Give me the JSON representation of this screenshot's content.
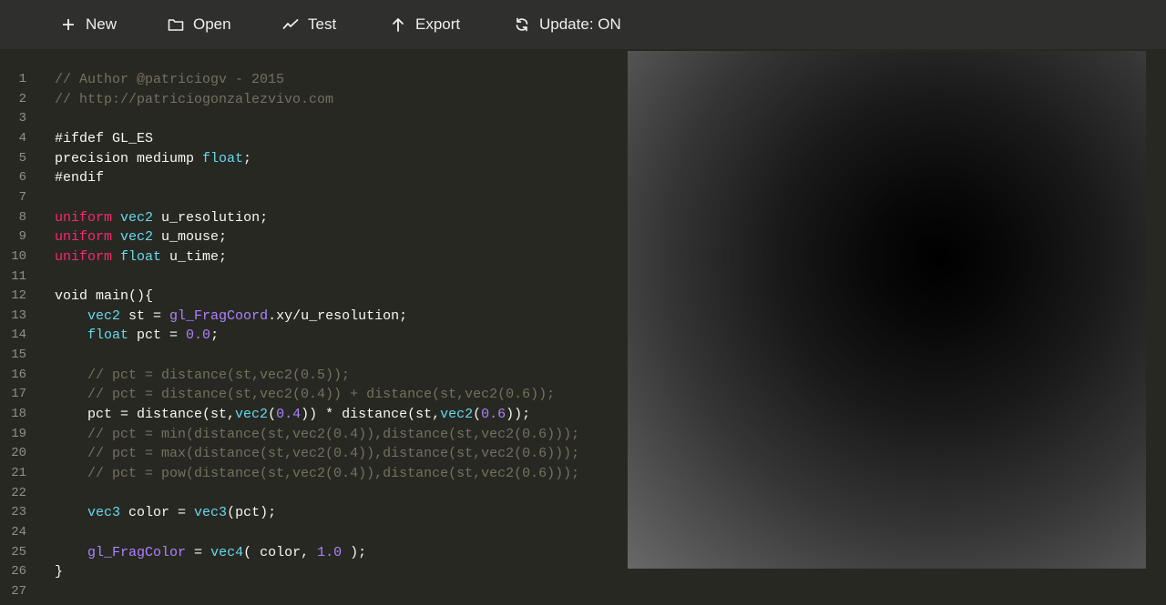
{
  "menu": {
    "items": [
      {
        "label": "New",
        "icon": "plus-icon"
      },
      {
        "label": "Open",
        "icon": "folder-icon"
      },
      {
        "label": "Test",
        "icon": "chart-line-icon"
      },
      {
        "label": "Export",
        "icon": "arrow-up-icon"
      },
      {
        "label": "Update: ON",
        "icon": "refresh-icon"
      }
    ]
  },
  "editor": {
    "line_numbers": [
      "1",
      "2",
      "3",
      "4",
      "5",
      "6",
      "7",
      "8",
      "9",
      "10",
      "11",
      "12",
      "13",
      "14",
      "15",
      "16",
      "17",
      "18",
      "19",
      "20",
      "21",
      "22",
      "23",
      "24",
      "25",
      "26",
      "27"
    ],
    "lines": [
      "// Author @patriciogv - 2015",
      "// http://patriciogonzalezvivo.com",
      "",
      "#ifdef GL_ES",
      "precision mediump float;",
      "#endif",
      "",
      "uniform vec2 u_resolution;",
      "uniform vec2 u_mouse;",
      "uniform float u_time;",
      "",
      "void main(){",
      "    vec2 st = gl_FragCoord.xy/u_resolution;",
      "    float pct = 0.0;",
      "",
      "    // pct = distance(st,vec2(0.5));",
      "    // pct = distance(st,vec2(0.4)) + distance(st,vec2(0.6));",
      "    pct = distance(st,vec2(0.4)) * distance(st,vec2(0.6));",
      "    // pct = min(distance(st,vec2(0.4)),distance(st,vec2(0.6)));",
      "    // pct = max(distance(st,vec2(0.4)),distance(st,vec2(0.6)));",
      "    // pct = pow(distance(st,vec2(0.4)),distance(st,vec2(0.6)));",
      "",
      "    vec3 color = vec3(pct);",
      "",
      "    gl_FragColor = vec4( color, 1.0 );",
      "}",
      ""
    ]
  },
  "colors": {
    "background": "#272822",
    "menubar": "#2f2f2d",
    "comment": "#75715e",
    "keyword": "#f92672",
    "type": "#66d9ef",
    "builtin": "#ae81ff",
    "number": "#ae81ff",
    "text": "#f8f8f2"
  }
}
